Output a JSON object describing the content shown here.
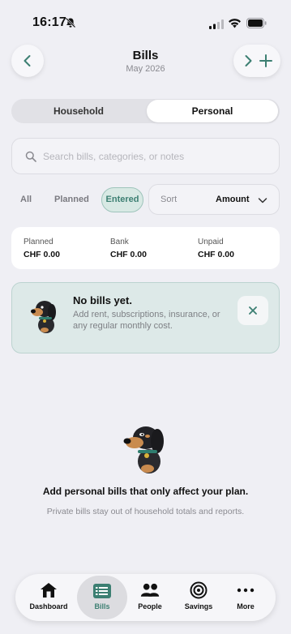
{
  "status_bar": {
    "time": "16:17"
  },
  "header": {
    "title": "Bills",
    "subtitle": "May 2026"
  },
  "segmented": {
    "options": [
      "Household",
      "Personal"
    ],
    "selected": "Personal"
  },
  "search": {
    "placeholder": "Search bills, categories, or notes",
    "value": ""
  },
  "filters": {
    "items": [
      "All",
      "Planned",
      "Entered"
    ],
    "selected": "Entered"
  },
  "sort": {
    "label": "Sort",
    "value": "Amount"
  },
  "totals": [
    {
      "label": "Planned",
      "value": "CHF 0.00"
    },
    {
      "label": "Bank",
      "value": "CHF 0.00"
    },
    {
      "label": "Unpaid",
      "value": "CHF 0.00"
    }
  ],
  "notice": {
    "title": "No bills yet.",
    "body": "Add rent, subscriptions, insurance, or any regular monthly cost."
  },
  "empty_state": {
    "title": "Add personal bills that only affect your plan.",
    "subtitle": "Private bills stay out of household totals and reports."
  },
  "tabbar": {
    "items": [
      {
        "label": "Dashboard",
        "icon": "house-icon"
      },
      {
        "label": "Bills",
        "icon": "bills-list-icon"
      },
      {
        "label": "People",
        "icon": "people-icon"
      },
      {
        "label": "Savings",
        "icon": "target-icon"
      },
      {
        "label": "More",
        "icon": "more-dots-icon"
      }
    ],
    "selected": "Bills"
  },
  "colors": {
    "accent": "#3c7f72",
    "background": "#efeff4",
    "notice_bg": "#dde9e8"
  }
}
